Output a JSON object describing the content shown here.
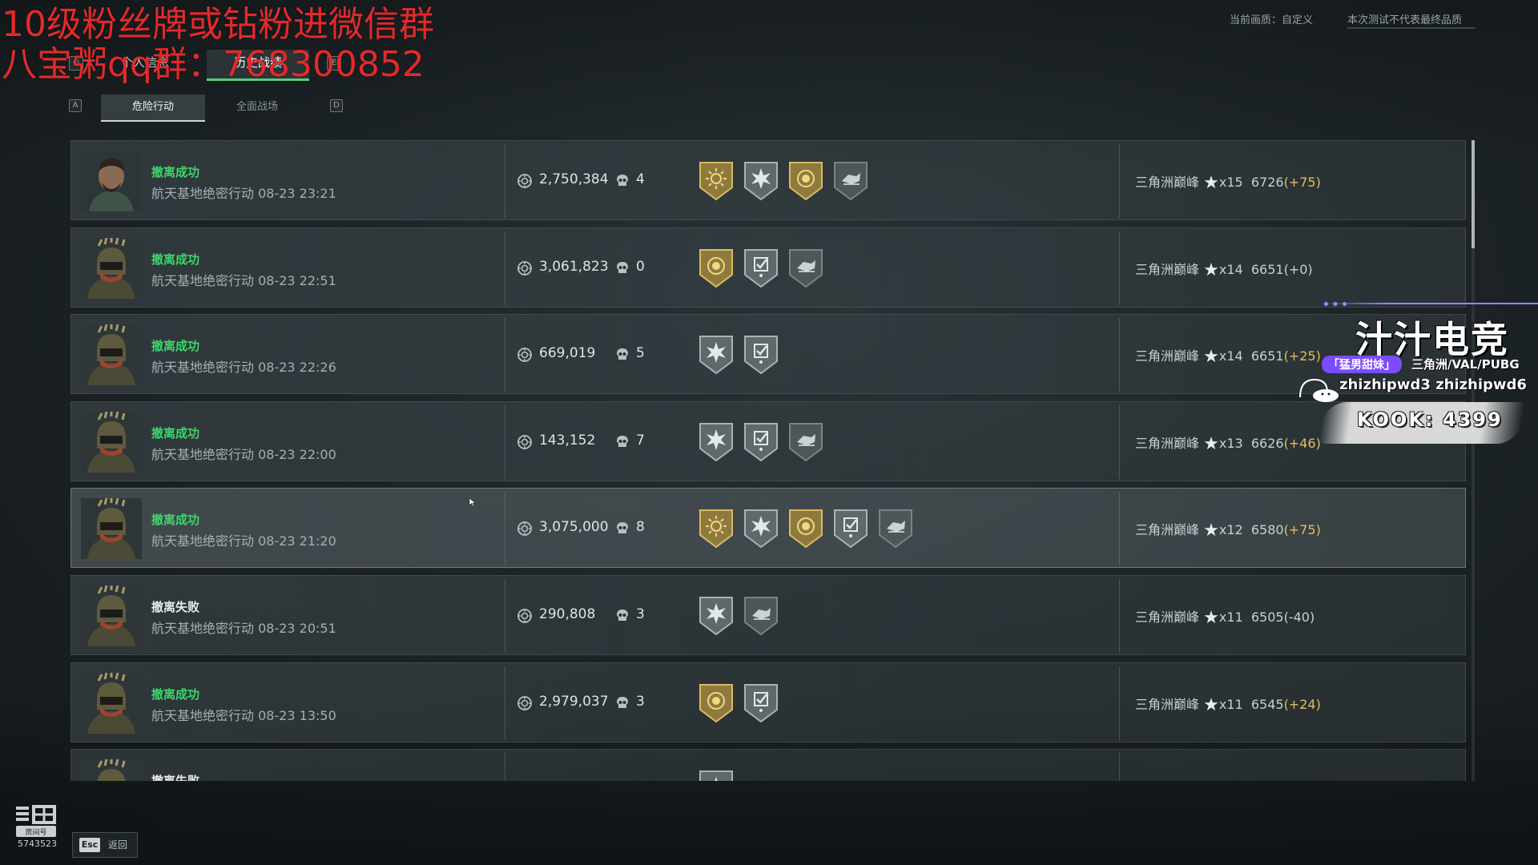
{
  "overlay": {
    "line1": "10级粉丝牌或钻粉进微信群",
    "line2": "八宝粥qq群：768300852"
  },
  "header": {
    "quality_label": "当前画质：自定义",
    "disclaimer": "本次测试不代表最终品质",
    "tabs": [
      {
        "key": "Q",
        "label": "个人信息",
        "active": false
      },
      {
        "key": "",
        "label": "历史战绩",
        "active": true
      },
      {
        "key": "E",
        "label": "",
        "active": false
      }
    ],
    "subtabs": [
      {
        "key": "A",
        "label": "危险行动",
        "active": true
      },
      {
        "key": "",
        "label": "全面战场",
        "active": false
      },
      {
        "key": "D",
        "label": "",
        "active": false
      }
    ]
  },
  "matches": [
    {
      "status": "撤离成功",
      "success": true,
      "detail": "航天基地绝密行动 08-23 23:21",
      "value": "2,750,384",
      "kills": "4",
      "medals": [
        "gold-sun",
        "silver-burst",
        "gold-coin",
        "grey-hand"
      ],
      "rank_label": "三角洲巅峰",
      "stars": "x15",
      "score": "6726",
      "delta": "(+75)"
    },
    {
      "status": "撤离成功",
      "success": true,
      "detail": "航天基地绝密行动 08-23 22:51",
      "value": "3,061,823",
      "kills": "0",
      "medals": [
        "gold-coin",
        "silver-check",
        "grey-hand"
      ],
      "rank_label": "三角洲巅峰",
      "stars": "x14",
      "score": "6651",
      "delta": "(+0)"
    },
    {
      "status": "撤离成功",
      "success": true,
      "detail": "航天基地绝密行动 08-23 22:26",
      "value": "669,019",
      "kills": "5",
      "medals": [
        "silver-burst",
        "silver-check"
      ],
      "rank_label": "三角洲巅峰",
      "stars": "x14",
      "score": "6651",
      "delta": "(+25)"
    },
    {
      "status": "撤离成功",
      "success": true,
      "detail": "航天基地绝密行动 08-23 22:00",
      "value": "143,152",
      "kills": "7",
      "medals": [
        "silver-burst",
        "silver-check",
        "grey-hand"
      ],
      "rank_label": "三角洲巅峰",
      "stars": "x13",
      "score": "6626",
      "delta": "(+46)"
    },
    {
      "status": "撤离成功",
      "success": true,
      "detail": "航天基地绝密行动 08-23 21:20",
      "value": "3,075,000",
      "kills": "8",
      "medals": [
        "gold-sun",
        "silver-burst",
        "gold-coin",
        "silver-check",
        "grey-hand"
      ],
      "rank_label": "三角洲巅峰",
      "stars": "x12",
      "score": "6580",
      "delta": "(+75)"
    },
    {
      "status": "撤离失败",
      "success": false,
      "detail": "航天基地绝密行动 08-23 20:51",
      "value": "290,808",
      "kills": "3",
      "medals": [
        "silver-burst",
        "grey-hand"
      ],
      "rank_label": "三角洲巅峰",
      "stars": "x11",
      "score": "6505",
      "delta": "(-40)"
    },
    {
      "status": "撤离成功",
      "success": true,
      "detail": "航天基地绝密行动 08-23 13:50",
      "value": "2,979,037",
      "kills": "3",
      "medals": [
        "gold-coin",
        "silver-check"
      ],
      "rank_label": "三角洲巅峰",
      "stars": "x11",
      "score": "6545",
      "delta": "(+24)"
    },
    {
      "status": "撤离失败",
      "success": false,
      "detail": "",
      "value": "",
      "kills": "",
      "medals": [
        "silver-burst"
      ],
      "rank_label": "",
      "stars": "",
      "score": "",
      "delta": ""
    }
  ],
  "watermark": {
    "title": "汁汁电竞",
    "tag": "「猛男甜妹」",
    "games": "三角洲/VAL/PUBG",
    "ids": "zhizhipwd3 zhizhipwd6",
    "kook": "KOOK: 4399"
  },
  "footer": {
    "room_id": "5743523",
    "esc_key": "Esc",
    "esc_label": "返回"
  },
  "colors": {
    "success": "#3fd46c",
    "fail": "#e6eaeb",
    "delta_positive": "#e2bf5a",
    "overlay_red": "#e22a2a",
    "accent_tab": "#4fd07c",
    "watermark_purple": "#7b4cff"
  }
}
